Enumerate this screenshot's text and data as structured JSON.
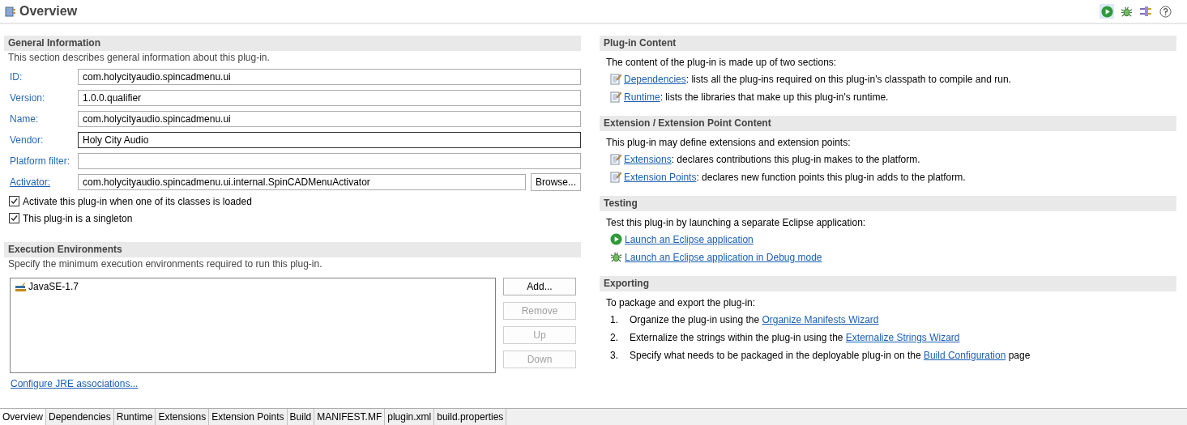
{
  "editor": {
    "title": "Overview"
  },
  "general": {
    "title": "General Information",
    "description": "This section describes general information about this plug-in.",
    "fields": [
      {
        "label": "ID:",
        "value": "com.holycityaudio.spincadmenu.ui",
        "kind": "text",
        "focused": false
      },
      {
        "label": "Version:",
        "value": "1.0.0.qualifier",
        "kind": "text",
        "focused": false
      },
      {
        "label": "Name:",
        "value": "com.holycityaudio.spincadmenu.ui",
        "kind": "text",
        "focused": false
      },
      {
        "label": "Vendor:",
        "value": "Holy City Audio",
        "kind": "text",
        "focused": true
      },
      {
        "label": "Platform filter:",
        "kind": "text",
        "focused": false
      },
      {
        "label": "Activator:",
        "value": "com.holycityaudio.spincadmenu.ui.internal.SpinCADMenuActivator",
        "kind": "browse",
        "button": "Browse...",
        "focused": false
      }
    ],
    "checkboxes": [
      {
        "label": "Activate this plug-in when one of its classes is loaded",
        "checked": true
      },
      {
        "label": "This plug-in is a singleton",
        "checked": true
      }
    ]
  },
  "execution": {
    "title": "Execution Environments",
    "description": "Specify the minimum execution environments required to run this plug-in.",
    "environments": [
      {
        "name": "JavaSE-1.7"
      }
    ],
    "buttons": [
      {
        "label": "Add...",
        "disabled": false
      },
      {
        "label": "Remove",
        "disabled": true
      },
      {
        "label": "Up",
        "disabled": true
      },
      {
        "label": "Down",
        "disabled": true
      }
    ],
    "link": "Configure JRE associations..."
  },
  "plugin_content": {
    "title": "Plug-in Content",
    "intro": "The content of the plug-in is made up of two sections:",
    "items": [
      {
        "link": "Dependencies",
        "text": ": lists all the plug-ins required on this plug-in's classpath to compile and run."
      },
      {
        "link": "Runtime",
        "text": ": lists the libraries that make up this plug-in's runtime."
      }
    ]
  },
  "extension_content": {
    "title": "Extension / Extension Point Content",
    "intro": "This plug-in may define extensions and extension points:",
    "items": [
      {
        "link": "Extensions",
        "text": ": declares contributions this plug-in makes to the platform."
      },
      {
        "link": "Extension Points",
        "text": ": declares new function points this plug-in adds to the platform."
      }
    ]
  },
  "testing": {
    "title": "Testing",
    "intro": "Test this plug-in by launching a separate Eclipse application:",
    "actions": [
      {
        "kind": "run",
        "label": "Launch an Eclipse application"
      },
      {
        "kind": "debug",
        "label": "Launch an Eclipse application in Debug mode"
      }
    ]
  },
  "exporting": {
    "title": "Exporting",
    "intro": "To package and export the plug-in:",
    "steps": [
      {
        "number": "1.",
        "before": "Organize the plug-in using the ",
        "link": "Organize Manifests Wizard"
      },
      {
        "number": "2.",
        "before": "Externalize the strings within the plug-in using the ",
        "link": "Externalize Strings Wizard"
      },
      {
        "number": "3.",
        "before": "Specify what needs to be packaged in the deployable plug-in on the ",
        "link": "Build Configuration",
        "after": " page"
      }
    ]
  },
  "tabs": [
    {
      "label": "Overview",
      "selected": true
    },
    {
      "label": "Dependencies",
      "selected": false
    },
    {
      "label": "Runtime",
      "selected": false
    },
    {
      "label": "Extensions",
      "selected": false
    },
    {
      "label": "Extension Points",
      "selected": false
    },
    {
      "label": "Build",
      "selected": false
    },
    {
      "label": "MANIFEST.MF",
      "selected": false
    },
    {
      "label": "plugin.xml",
      "selected": false
    },
    {
      "label": "build.properties",
      "selected": false
    }
  ]
}
